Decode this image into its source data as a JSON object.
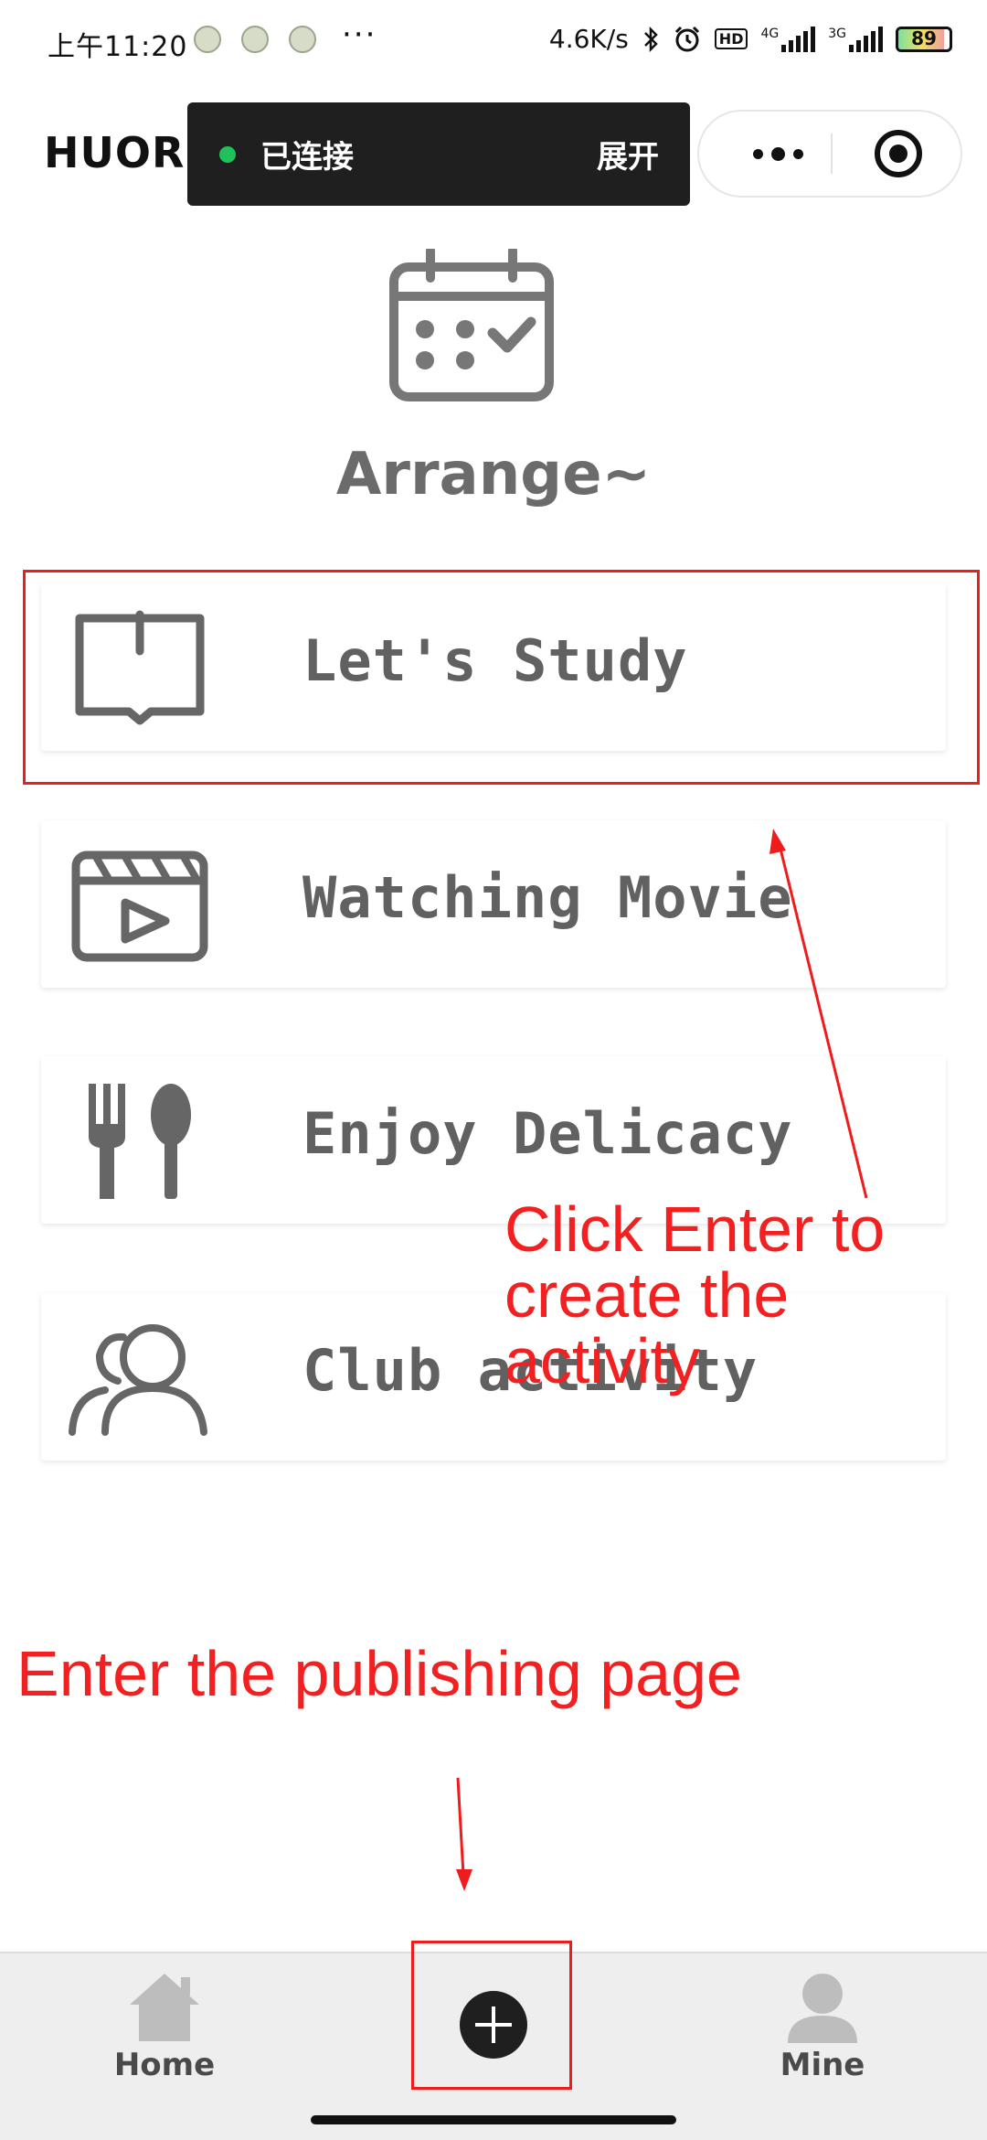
{
  "status_bar": {
    "time": "上午11:20",
    "more": "···",
    "network_speed": "4.6K/s",
    "hd_badge": "HD",
    "network_4g": "4G",
    "network_3g": "3G",
    "battery": "89"
  },
  "header": {
    "app_name": "HUOR",
    "connection_status": "已连接",
    "expand_label": "展开"
  },
  "hero": {
    "icon": "calendar-check-icon",
    "title": "Arrange~"
  },
  "activities": [
    {
      "label": "Let's Study",
      "icon": "book-icon"
    },
    {
      "label": "Watching Movie",
      "icon": "clapperboard-icon"
    },
    {
      "label": "Enjoy Delicacy",
      "icon": "fork-spoon-icon"
    },
    {
      "label": "Club activity",
      "icon": "group-icon"
    }
  ],
  "annotations": {
    "create_hint": "Click Enter to create the activity",
    "publish_hint": "Enter the publishing page",
    "color": "#f22020"
  },
  "tab_bar": {
    "home_label": "Home",
    "add_icon": "plus-circle-icon",
    "mine_label": "Mine"
  },
  "colors": {
    "card_text": "#616161",
    "pill_bg": "#1f1f1f",
    "connected_dot": "#20c15a",
    "tab_bar_bg": "#eeeeee"
  }
}
